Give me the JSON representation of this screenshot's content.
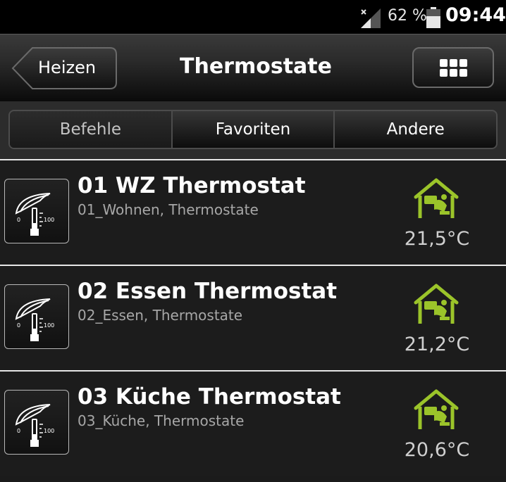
{
  "status_bar": {
    "battery_percent": "62 %",
    "time": "09:44",
    "signal_icon": "signal-no-sim-icon",
    "battery_icon": "battery-icon"
  },
  "action_bar": {
    "back_label": "Heizen",
    "title": "Thermostate",
    "grid_icon": "grid-menu-icon"
  },
  "tabs": [
    {
      "label": "Befehle",
      "active": true
    },
    {
      "label": "Favoriten",
      "active": false
    },
    {
      "label": "Andere",
      "active": false
    }
  ],
  "devices": [
    {
      "title": "01 WZ Thermostat",
      "subtitle": "01_Wohnen, Thermostate",
      "temperature": "21,5°C",
      "icon": "thermostat-icon",
      "status_icon": "home-comfort-icon"
    },
    {
      "title": "02 Essen Thermostat",
      "subtitle": "02_Essen, Thermostate",
      "temperature": "21,2°C",
      "icon": "thermostat-icon",
      "status_icon": "home-comfort-icon"
    },
    {
      "title": "03 Küche Thermostat",
      "subtitle": "03_Küche, Thermostate",
      "temperature": "20,6°C",
      "icon": "thermostat-icon",
      "status_icon": "home-comfort-icon"
    }
  ],
  "colors": {
    "accent_green": "#9bc42a",
    "background": "#1b1b1b"
  }
}
